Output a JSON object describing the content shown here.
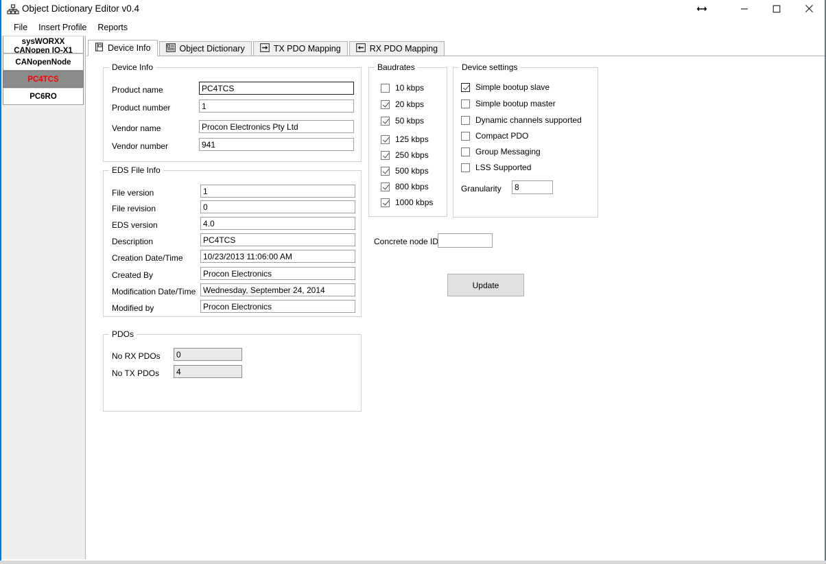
{
  "window": {
    "title": "Object Dictionary Editor v0.4",
    "app_icon": "hierarchy-icon",
    "resize_cursor": "horizontal-resize-cursor",
    "controls": {
      "minimize": "—",
      "maximize": "□",
      "close": "✕"
    }
  },
  "menu": {
    "items": [
      {
        "label": "File"
      },
      {
        "label": "Insert Profile"
      },
      {
        "label": "Reports"
      }
    ]
  },
  "sidebar": {
    "items": [
      {
        "label": "sysWORXX CANopen IO-X1",
        "selected": false
      },
      {
        "label": "CANopenNode",
        "selected": false
      },
      {
        "label": "PC4TCS",
        "selected": true
      },
      {
        "label": "PC6RO",
        "selected": false
      }
    ],
    "selected_color": "#ff0000",
    "selected_background": "#8b8b8b"
  },
  "tabs": [
    {
      "label": "Device Info",
      "icon": "document-page-icon",
      "active": true
    },
    {
      "label": "Object Dictionary",
      "icon": "list-details-icon",
      "active": false
    },
    {
      "label": "TX PDO Mapping",
      "icon": "arrow-right-box-icon",
      "active": false
    },
    {
      "label": "RX PDO Mapping",
      "icon": "arrow-left-box-icon",
      "active": false
    }
  ],
  "device_info": {
    "title": "Device Info",
    "fields": [
      {
        "label": "Product name",
        "value": "PC4TCS",
        "focused": true
      },
      {
        "label": "Product number",
        "value": "1",
        "focused": false
      },
      {
        "label": "Vendor name",
        "value": "Procon Electronics Pty Ltd",
        "focused": false
      },
      {
        "label": "Vendor number",
        "value": "941",
        "focused": false
      }
    ]
  },
  "eds_file_info": {
    "title": "EDS File Info",
    "fields": [
      {
        "label": "File version",
        "value": "1"
      },
      {
        "label": "File revision",
        "value": "0"
      },
      {
        "label": "EDS version",
        "value": "4.0"
      },
      {
        "label": "Description",
        "value": "PC4TCS"
      },
      {
        "label": "Creation Date/Time",
        "value": "10/23/2013 11:06:00 AM"
      },
      {
        "label": "Created By",
        "value": "Procon Electronics"
      },
      {
        "label": "Modification Date/Time",
        "value": "Wednesday, September 24, 2014"
      },
      {
        "label": "Modified by",
        "value": "Procon Electronics"
      }
    ]
  },
  "pdos": {
    "title": "PDOs",
    "fields": [
      {
        "label": "No RX PDOs",
        "value": "0"
      },
      {
        "label": "No TX PDOs",
        "value": "4"
      }
    ]
  },
  "baudrates": {
    "title": "Baudrates",
    "items": [
      {
        "label": "10 kbps",
        "checked": false
      },
      {
        "label": "20 kbps",
        "checked": true
      },
      {
        "label": "50 kbps",
        "checked": true
      },
      {
        "label": "125 kbps",
        "checked": true
      },
      {
        "label": "250 kbps",
        "checked": true
      },
      {
        "label": "500 kbps",
        "checked": true
      },
      {
        "label": "800 kbps",
        "checked": true
      },
      {
        "label": "1000 kbps",
        "checked": true
      }
    ]
  },
  "device_settings": {
    "title": "Device settings",
    "items": [
      {
        "label": "Simple bootup slave",
        "checked": true,
        "focused": true
      },
      {
        "label": "Simple bootup master",
        "checked": false,
        "focused": false
      },
      {
        "label": "Dynamic channels supported",
        "checked": false,
        "focused": false
      },
      {
        "label": "Compact PDO",
        "checked": false,
        "focused": false
      },
      {
        "label": "Group Messaging",
        "checked": false,
        "focused": false
      },
      {
        "label": "LSS Supported",
        "checked": false,
        "focused": false
      }
    ],
    "granularity": {
      "label": "Granularity",
      "value": "8"
    }
  },
  "concrete_node": {
    "label": "Concrete node ID",
    "value": ""
  },
  "update_button": {
    "label": "Update"
  }
}
